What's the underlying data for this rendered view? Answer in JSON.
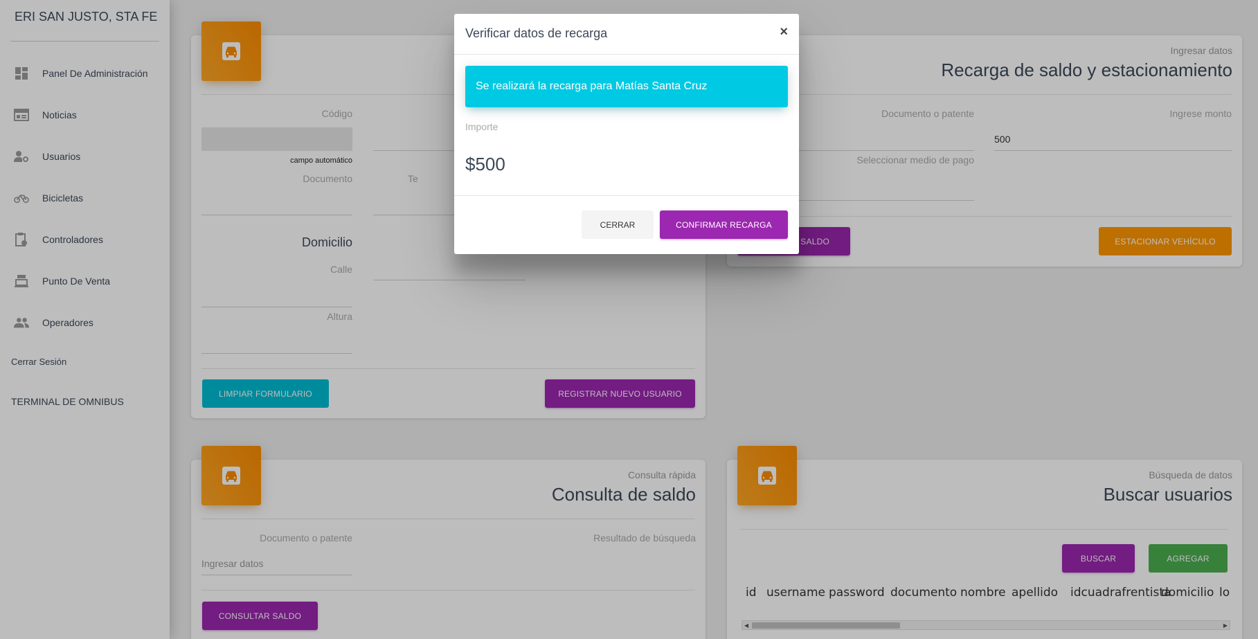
{
  "sidebar": {
    "brand": "ERI SAN JUSTO, STA FE",
    "items": [
      {
        "label": "Panel De Administración",
        "icon": "dashboard-icon"
      },
      {
        "label": "Noticias",
        "icon": "news-icon"
      },
      {
        "label": "Usuarios",
        "icon": "user-settings-icon"
      },
      {
        "label": "Bicicletas",
        "icon": "bicycle-icon"
      },
      {
        "label": "Controladores",
        "icon": "clipboard-clock-icon"
      },
      {
        "label": "Punto De Venta",
        "icon": "cash-register-icon"
      },
      {
        "label": "Operadores",
        "icon": "people-icon"
      }
    ],
    "logout": "Cerrar Sesión",
    "location": "TERMINAL DE OMNIBUS"
  },
  "register_card": {
    "codigo_label": "Código",
    "codigo_hint": "campo automático",
    "documento_label": "Documento",
    "te_label": "Te",
    "domicilio_heading": "Domicilio",
    "calle_label": "Calle",
    "altura_label": "Altura",
    "clear_button": "LIMPIAR FORMULARIO",
    "register_button": "REGISTRAR NUEVO USUARIO"
  },
  "recharge_card": {
    "category": "Ingresar datos",
    "title": "Recarga de saldo y estacionamiento",
    "documento_label": "Documento o patente",
    "monto_label": "Ingrese monto",
    "monto_value": "500",
    "medio_pago_label": "Seleccionar medio de pago",
    "recharge_button": "R SALDO",
    "park_button": "ESTACIONAR VEHÍCULO"
  },
  "balance_card": {
    "category": "Consulta rápida",
    "title": "Consulta de saldo",
    "documento_label": "Documento o patente",
    "documento_placeholder": "Ingresar datos",
    "result_label": "Resultado de búsqueda",
    "query_button": "CONSULTAR SALDO"
  },
  "search_card": {
    "category": "Búsqueda de datos",
    "title": "Buscar usuarios",
    "search_button": "BUSCAR",
    "add_button": "AGREGAR",
    "columns": [
      "id",
      "username",
      "password",
      "documento",
      "nombre",
      "apellido",
      "idcuadrafrentista",
      "domicilio",
      "lo"
    ]
  },
  "modal": {
    "title": "Verificar datos de recarga",
    "close_symbol": "×",
    "alert_text": "Se realizará la recarga para Matías Santa Cruz",
    "importe_label": "Importe",
    "importe_value": "$500",
    "cancel_button": "CERRAR",
    "confirm_button": "CONFIRMAR RECARGA"
  },
  "colors": {
    "accent_purple": "#9c27b0",
    "accent_orange": "#ff9800",
    "accent_cyan": "#00bcd4",
    "accent_green": "#4caf50"
  }
}
